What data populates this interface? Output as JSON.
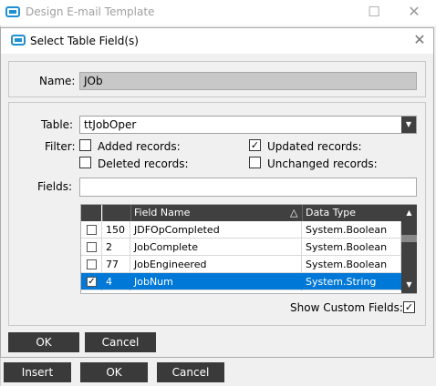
{
  "outer_window": {
    "title": "Design E-mail Template",
    "maximize_glyph": "☐",
    "close_glyph": "✕"
  },
  "dialog": {
    "title": "Select Table Field(s)",
    "close_glyph": "✕"
  },
  "name": {
    "label": "Name:",
    "value": "JOb"
  },
  "table": {
    "label": "Table:",
    "value": "ttJobOper",
    "dropdown_glyph": "▼"
  },
  "filter": {
    "label": "Filter:",
    "options": [
      {
        "label": "Added records:",
        "checked": false
      },
      {
        "label": "Updated records:",
        "checked": true
      },
      {
        "label": "Deleted records:",
        "checked": false
      },
      {
        "label": "Unchanged records:",
        "checked": false
      }
    ]
  },
  "fields": {
    "label": "Fields:",
    "value": ""
  },
  "grid": {
    "columns": [
      "",
      "",
      "Field Name",
      "Data Type"
    ],
    "sort_glyph": "△",
    "rows": [
      {
        "checked": false,
        "id": "150",
        "field": "JDFOpCompleted",
        "type": "System.Boolean",
        "selected": false
      },
      {
        "checked": false,
        "id": "2",
        "field": "JobComplete",
        "type": "System.Boolean",
        "selected": false
      },
      {
        "checked": false,
        "id": "77",
        "field": "JobEngineered",
        "type": "System.Boolean",
        "selected": false
      },
      {
        "checked": true,
        "id": "4",
        "field": "JobNum",
        "type": "System.String",
        "selected": true
      }
    ],
    "scroll_up_glyph": "▲",
    "scroll_down_glyph": "▼"
  },
  "show_custom": {
    "label": "Show Custom Fields:",
    "checked": true
  },
  "dialog_buttons": {
    "ok": "OK",
    "cancel": "Cancel"
  },
  "outer_buttons": {
    "insert": "Insert",
    "ok": "OK",
    "cancel": "Cancel"
  },
  "colors": {
    "selected_row": "#0078d7",
    "header_bg": "#404040",
    "button_bg": "#3a3a3a",
    "app_icon": "#1e8fd1"
  },
  "icons": {
    "app": "window-icon",
    "dialog": "window-icon"
  }
}
